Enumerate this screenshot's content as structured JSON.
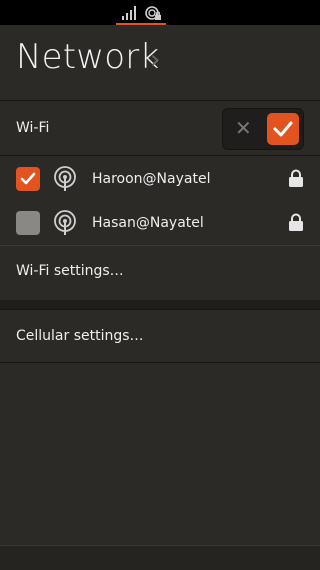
{
  "status_bar": {
    "indicators": [
      {
        "icon": "signal-bars-icon"
      },
      {
        "icon": "network-secure-icon"
      }
    ]
  },
  "header": {
    "title": "Network",
    "chevron": "›"
  },
  "wifi": {
    "label": "Wi-Fi",
    "enabled": true,
    "toggle_off_glyph": "✕",
    "toggle_on_glyph": "✓"
  },
  "networks": [
    {
      "name": "Haroon@Nayatel",
      "selected": true,
      "secured": true
    },
    {
      "name": "Hasan@Nayatel",
      "selected": false,
      "secured": true
    }
  ],
  "links": {
    "wifi_settings": "Wi-Fi settings…",
    "cellular_settings": "Cellular settings…"
  },
  "colors": {
    "accent": "#e2541f",
    "background": "#2c2a27"
  }
}
